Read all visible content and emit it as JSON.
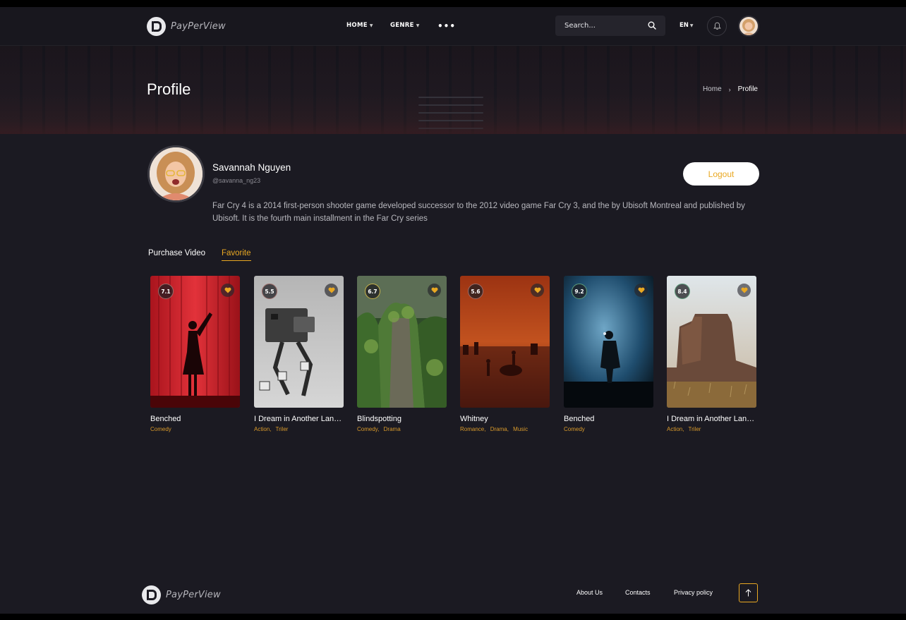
{
  "app": {
    "name": "PayPerView"
  },
  "nav": {
    "home": "HOME",
    "genre": "GENRE",
    "more": "•••"
  },
  "search": {
    "placeholder": "Search..."
  },
  "lang": {
    "current": "EN"
  },
  "hero": {
    "title": "Profile",
    "breadcrumb": {
      "home": "Home",
      "separator": "›",
      "current": "Profile"
    }
  },
  "profile": {
    "name": "Savannah Nguyen",
    "handle": "@savanna_ng23",
    "bio": "Far Cry 4 is a 2014 first-person shooter game developed  successor to the 2012 video game Far Cry 3, and the  by Ubisoft Montreal and published by Ubisoft. It is the fourth main installment in the Far Cry series",
    "logout_label": "Logout"
  },
  "tabs": [
    {
      "label": "Purchase Video",
      "active": false
    },
    {
      "label": "Favorite",
      "active": true
    }
  ],
  "movies": [
    {
      "title": "Benched",
      "rating": "7.1",
      "genres": [
        "Comedy"
      ],
      "poster": "red-curtain-silhouette"
    },
    {
      "title": "I Dream in Another Language",
      "rating": "5.5",
      "genres": [
        "Action,",
        "Triler"
      ],
      "poster": "walker-robot"
    },
    {
      "title": "Blindspotting",
      "rating": "6.7",
      "genres": [
        "Comedy,",
        "Drama"
      ],
      "poster": "green-cliffs"
    },
    {
      "title": "Whitney",
      "rating": "5.6",
      "genres": [
        "Romance,",
        "Drama,",
        "Music"
      ],
      "poster": "orange-city"
    },
    {
      "title": "Benched",
      "rating": "9.2",
      "genres": [
        "Comedy"
      ],
      "poster": "blue-figure"
    },
    {
      "title": "I Dream in Another Language",
      "rating": "8.4",
      "genres": [
        "Action,",
        "Triler"
      ],
      "poster": "desert-butte"
    }
  ],
  "footer": {
    "links": [
      "About Us",
      "Contacts",
      "Privacy policy"
    ]
  },
  "colors": {
    "accent": "#e9a822",
    "background": "#1b1a22",
    "header": "#18171e"
  }
}
